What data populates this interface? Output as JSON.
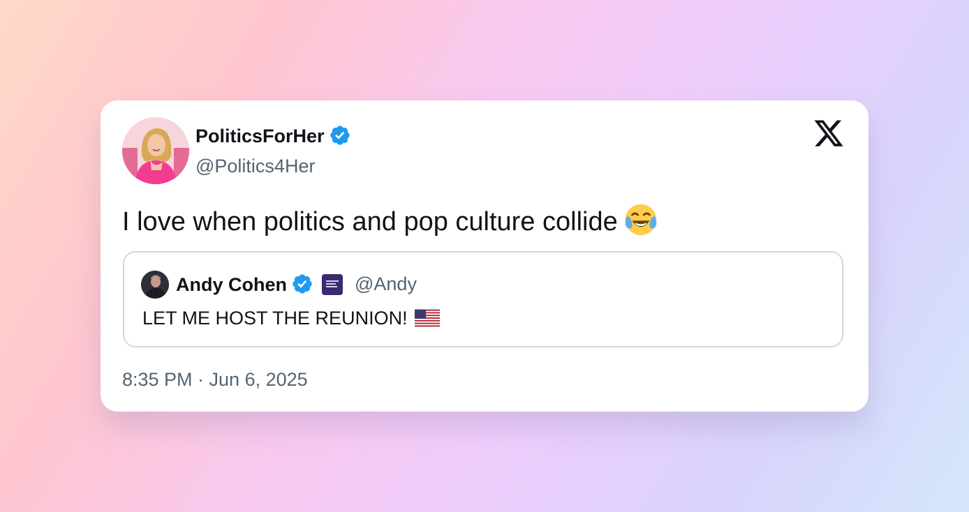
{
  "tweet": {
    "author": {
      "name": "PoliticsForHer",
      "handle": "@Politics4Her",
      "verified": true,
      "avatar": "woman-in-pink-avatar"
    },
    "text": "I love when politics and pop culture collide",
    "emoji": "face-with-tears-of-joy",
    "timestamp": "8:35 PM · Jun 6, 2025",
    "brand_icon": "x-logo-icon"
  },
  "quoted": {
    "name": "Andy Cohen",
    "handle": "@Andy",
    "verified": true,
    "affiliate_icon": "affiliate-badge-icon",
    "text": "LET ME HOST THE REUNION!",
    "emoji": "us-flag"
  },
  "colors": {
    "verified_blue": "#1d9bf0",
    "text_primary": "#0f1419",
    "text_secondary": "#536471",
    "border": "#cfd9de"
  }
}
